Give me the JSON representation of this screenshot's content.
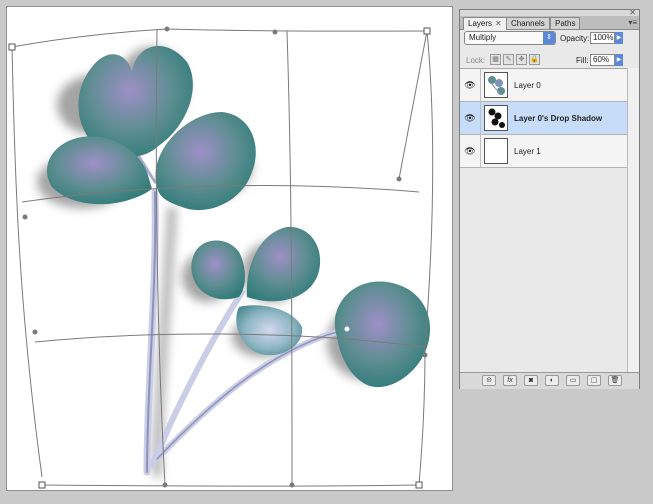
{
  "panel": {
    "tabs": [
      {
        "label": "Layers",
        "close": "✕"
      },
      {
        "label": "Channels"
      },
      {
        "label": "Paths"
      }
    ],
    "close_icon": "✕",
    "menu_icon": "▾≡",
    "blend_mode": "Multiply",
    "opacity_label": "Opacity:",
    "opacity_value": "100%",
    "lock_label": "Lock:",
    "fill_label": "Fill:",
    "fill_value": "60%",
    "layers": [
      {
        "name": "Layer 0",
        "visible": true,
        "selected": false
      },
      {
        "name": "Layer 0's Drop Shadow",
        "visible": true,
        "selected": true
      },
      {
        "name": "Layer 1",
        "visible": true,
        "selected": false
      }
    ],
    "footer_buttons": [
      "link-icon",
      "fx-icon",
      "mask-icon",
      "adjustment-icon",
      "folder-icon",
      "new-layer-icon",
      "trash-icon"
    ],
    "footer_glyphs": [
      "⊝",
      "fx",
      "◙",
      "◐",
      "▭",
      "▢",
      "🗑"
    ]
  },
  "colors": {
    "selection": "#c7dcf8",
    "accent": "#5b88d8",
    "leaf_teal": "#4f8f8c",
    "leaf_purple": "#8e82b6"
  }
}
